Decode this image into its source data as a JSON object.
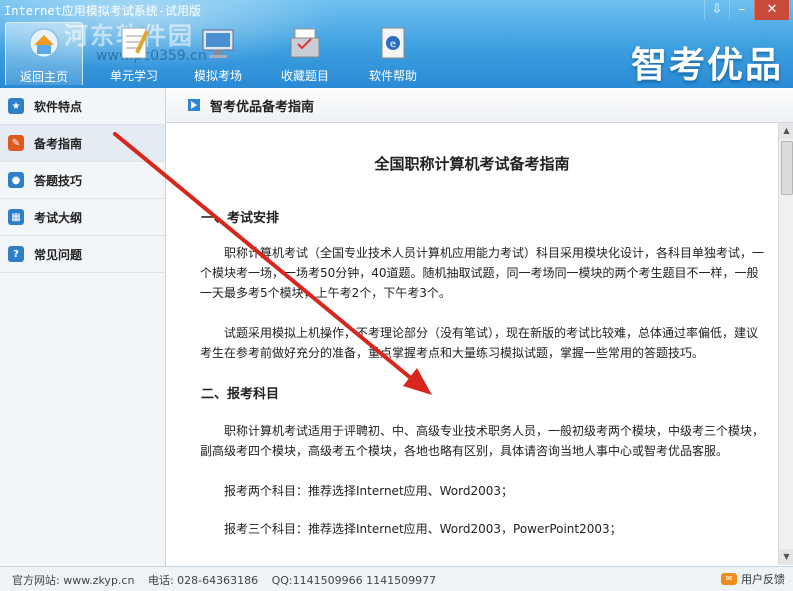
{
  "window": {
    "title": "Internet应用模拟考试系统-试用版",
    "controls": [
      "⇩",
      "–",
      "✕"
    ]
  },
  "watermark": {
    "line1": "河东软件园",
    "line2": "www.pc0359.cn"
  },
  "brand": {
    "logo_text": "智考优品"
  },
  "nav": [
    {
      "label": "返回主页",
      "icon": "home-icon"
    },
    {
      "label": "单元学习",
      "icon": "notebook-icon"
    },
    {
      "label": "模拟考场",
      "icon": "monitor-icon"
    },
    {
      "label": "收藏题目",
      "icon": "folder-icon"
    },
    {
      "label": "软件帮助",
      "icon": "help-book-icon"
    }
  ],
  "sidebar": {
    "items": [
      {
        "label": "软件特点",
        "icon": "star-icon"
      },
      {
        "label": "备考指南",
        "icon": "guide-icon"
      },
      {
        "label": "答题技巧",
        "icon": "chat-icon"
      },
      {
        "label": "考试大纲",
        "icon": "calendar-icon"
      },
      {
        "label": "常见问题",
        "icon": "question-icon"
      }
    ],
    "active": "备考指南"
  },
  "content": {
    "header_title": "智考优品备考指南",
    "doc_title": "全国职称计算机考试备考指南",
    "section1_heading": "一、考试安排",
    "section1_p1": "职称计算机考试（全国专业技术人员计算机应用能力考试）科目采用模块化设计，各科目单独考试，一个模块考一场，一场考50分钟，40道题。随机抽取试题，同一考场同一模块的两个考生题目不一样，一般一天最多考5个模块，上午考2个，下午考3个。",
    "section1_p2": "试题采用模拟上机操作，不考理论部分（没有笔试），现在新版的考试比较难，总体通过率偏低，建议考生在参考前做好充分的准备，重点掌握考点和大量练习模拟试题，掌握一些常用的答题技巧。",
    "section2_heading": "二、报考科目",
    "section2_p1": "职称计算机考试适用于评聘初、中、高级专业技术职务人员，一般初级考两个模块，中级考三个模块，副高级考四个模块，高级考五个模块，各地也略有区别，具体请咨询当地人事中心或智考优品客服。",
    "section2_p2": "报考两个科目：推荐选择Internet应用、Word2003；",
    "section2_p3": "报考三个科目：推荐选择Internet应用、Word2003，PowerPoint2003；"
  },
  "footer": {
    "website": "官方网站: www.zkyp.cn",
    "phone": "电话: 028-64363186",
    "qq": "QQ:1141509966 1141509977",
    "feedback": "用户反馈"
  },
  "colors": {
    "header": "#3c9fe0",
    "annotation_arrow": "#d9261c",
    "accent": "#2d86d3"
  }
}
